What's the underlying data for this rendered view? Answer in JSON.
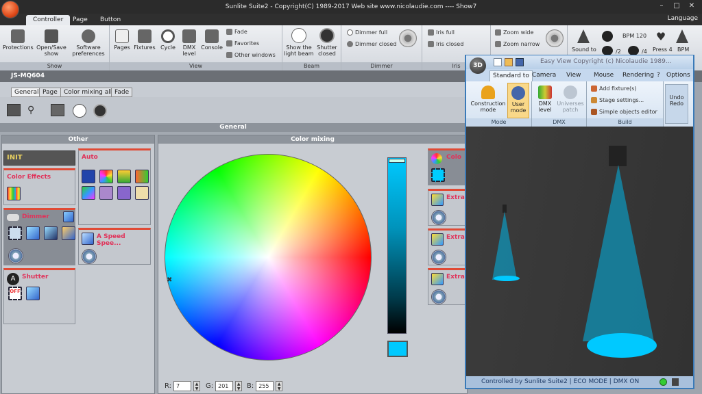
{
  "window": {
    "title": "Sunlite Suite2 - Copyright(C) 1989-2017   Web site www.nicolaudie.com ---- Show7",
    "language": "Language"
  },
  "ribbon_tabs": [
    "Controller",
    "Page",
    "Button"
  ],
  "ribbon": {
    "show": {
      "label": "Show",
      "items": [
        "Protections",
        "Open/Save show",
        "Software preferences"
      ]
    },
    "view": {
      "label": "View",
      "items": [
        "Pages",
        "Fixtures",
        "Cycle",
        "DMX level",
        "Console"
      ],
      "small": [
        "Fade",
        "Favorites",
        "Other windows"
      ]
    },
    "beam": {
      "label": "Beam",
      "items": [
        "Show the light beam",
        "Shutter closed"
      ]
    },
    "dimmer": {
      "label": "Dimmer",
      "items": [
        "Dimmer full",
        "Dimmer closed"
      ]
    },
    "iris": {
      "label": "Iris",
      "items": [
        "Iris full",
        "Iris closed"
      ]
    },
    "zoom": {
      "items": [
        "Zoom wide",
        "Zoom narrow"
      ]
    },
    "tempo": {
      "sound_to": "Sound to",
      "bpm": "BPM 120",
      "press": "Press 4",
      "bpm_label": "BPM",
      "half": "/2",
      "quarter": "/4"
    }
  },
  "fixture_name": "JS-MQ604",
  "sub_tabs": [
    "General",
    "Page",
    "Color mixing all",
    "Fade"
  ],
  "general_header": "General",
  "other": {
    "header": "Other",
    "init": "INIT",
    "color_effects": "Color Effects",
    "dimmer": "Dimmer",
    "shutter": "Shutter",
    "shutter_off": "OFF",
    "auto": "Auto",
    "speed": "A Speed Spee..."
  },
  "color_mixing": {
    "header": "Color mixing",
    "r_label": "R:",
    "r": "7",
    "g_label": "G:",
    "g": "201",
    "b_label": "B:",
    "b": "255",
    "side": [
      "Colo",
      "Extra",
      "Extra",
      "Extra"
    ]
  },
  "easy_view": {
    "title": "Easy View   Copyright (c) Nicolaudie 1989...",
    "logo": "3D",
    "tabs": [
      "Standard to",
      "Camera",
      "View",
      "Mouse",
      "Rendering",
      "?",
      "Options"
    ],
    "mode": {
      "label": "Mode",
      "items": [
        "Construction mode",
        "User mode"
      ]
    },
    "dmx": {
      "label": "DMX",
      "items": [
        "DMX level",
        "Universes patch"
      ]
    },
    "build": {
      "label": "Build",
      "items": [
        "Add fixture(s)",
        "Stage settings...",
        "Simple objects editor"
      ]
    },
    "undo": "Undo",
    "redo": "Redo",
    "status": "Controlled by Sunlite Suite2  |  ECO MODE  |  DMX ON"
  },
  "colors": {
    "accent": "#00c9ff",
    "title_red": "#e0335a"
  }
}
